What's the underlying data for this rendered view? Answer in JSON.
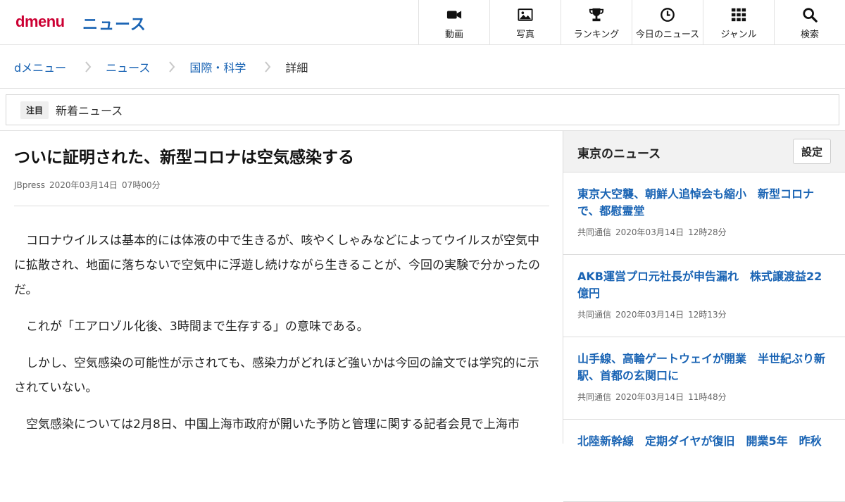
{
  "header": {
    "logo": "dmenu",
    "section": "ニュース",
    "nav": [
      {
        "icon": "video-camera-icon",
        "label": "動画"
      },
      {
        "icon": "photo-icon",
        "label": "写真"
      },
      {
        "icon": "trophy-icon",
        "label": "ランキング"
      },
      {
        "icon": "clock-icon",
        "label": "今日のニュース"
      },
      {
        "icon": "grid-icon",
        "label": "ジャンル"
      },
      {
        "icon": "search-icon",
        "label": "検索"
      }
    ]
  },
  "breadcrumb": [
    "dメニュー",
    "ニュース",
    "国際・科学",
    "詳細"
  ],
  "notice": {
    "badge": "注目",
    "text": "新着ニュース"
  },
  "article": {
    "title": "ついに証明された、新型コロナは空気感染する",
    "source": "JBpress",
    "date": "2020年03月14日",
    "time": "07時00分",
    "paragraphs": [
      "コロナウイルスは基本的には体液の中で生きるが、咳やくしゃみなどによってウイルスが空気中に拡散され、地面に落ちないで空気中に浮遊し続けながら生きることが、今回の実験で分かったのだ。",
      "これが「エアロゾル化後、3時間まで生存する」の意味である。",
      "しかし、空気感染の可能性が示されても、感染力がどれほど強いかは今回の論文では学究的に示されていない。",
      "空気感染については2月8日、中国上海市政府が開いた予防と管理に関する記者会見で上海市"
    ]
  },
  "sidebar": {
    "title": "東京のニュース",
    "settings_label": "設定",
    "items": [
      {
        "headline": "東京大空襲、朝鮮人追悼会も縮小　新型コロナで、都慰霊堂",
        "source": "共同通信",
        "date": "2020年03月14日",
        "time": "12時28分"
      },
      {
        "headline": "AKB運営プロ元社長が申告漏れ　株式譲渡益22億円",
        "source": "共同通信",
        "date": "2020年03月14日",
        "time": "12時13分"
      },
      {
        "headline": "山手線、高輪ゲートウェイが開業　半世紀ぶり新駅、首都の玄関口に",
        "source": "共同通信",
        "date": "2020年03月14日",
        "time": "11時48分"
      },
      {
        "headline": "北陸新幹線　定期ダイヤが復旧　開業5年　昨秋",
        "source": "",
        "date": "",
        "time": ""
      }
    ]
  },
  "colors": {
    "brand": "#cc0033",
    "link": "#1a64b4"
  }
}
